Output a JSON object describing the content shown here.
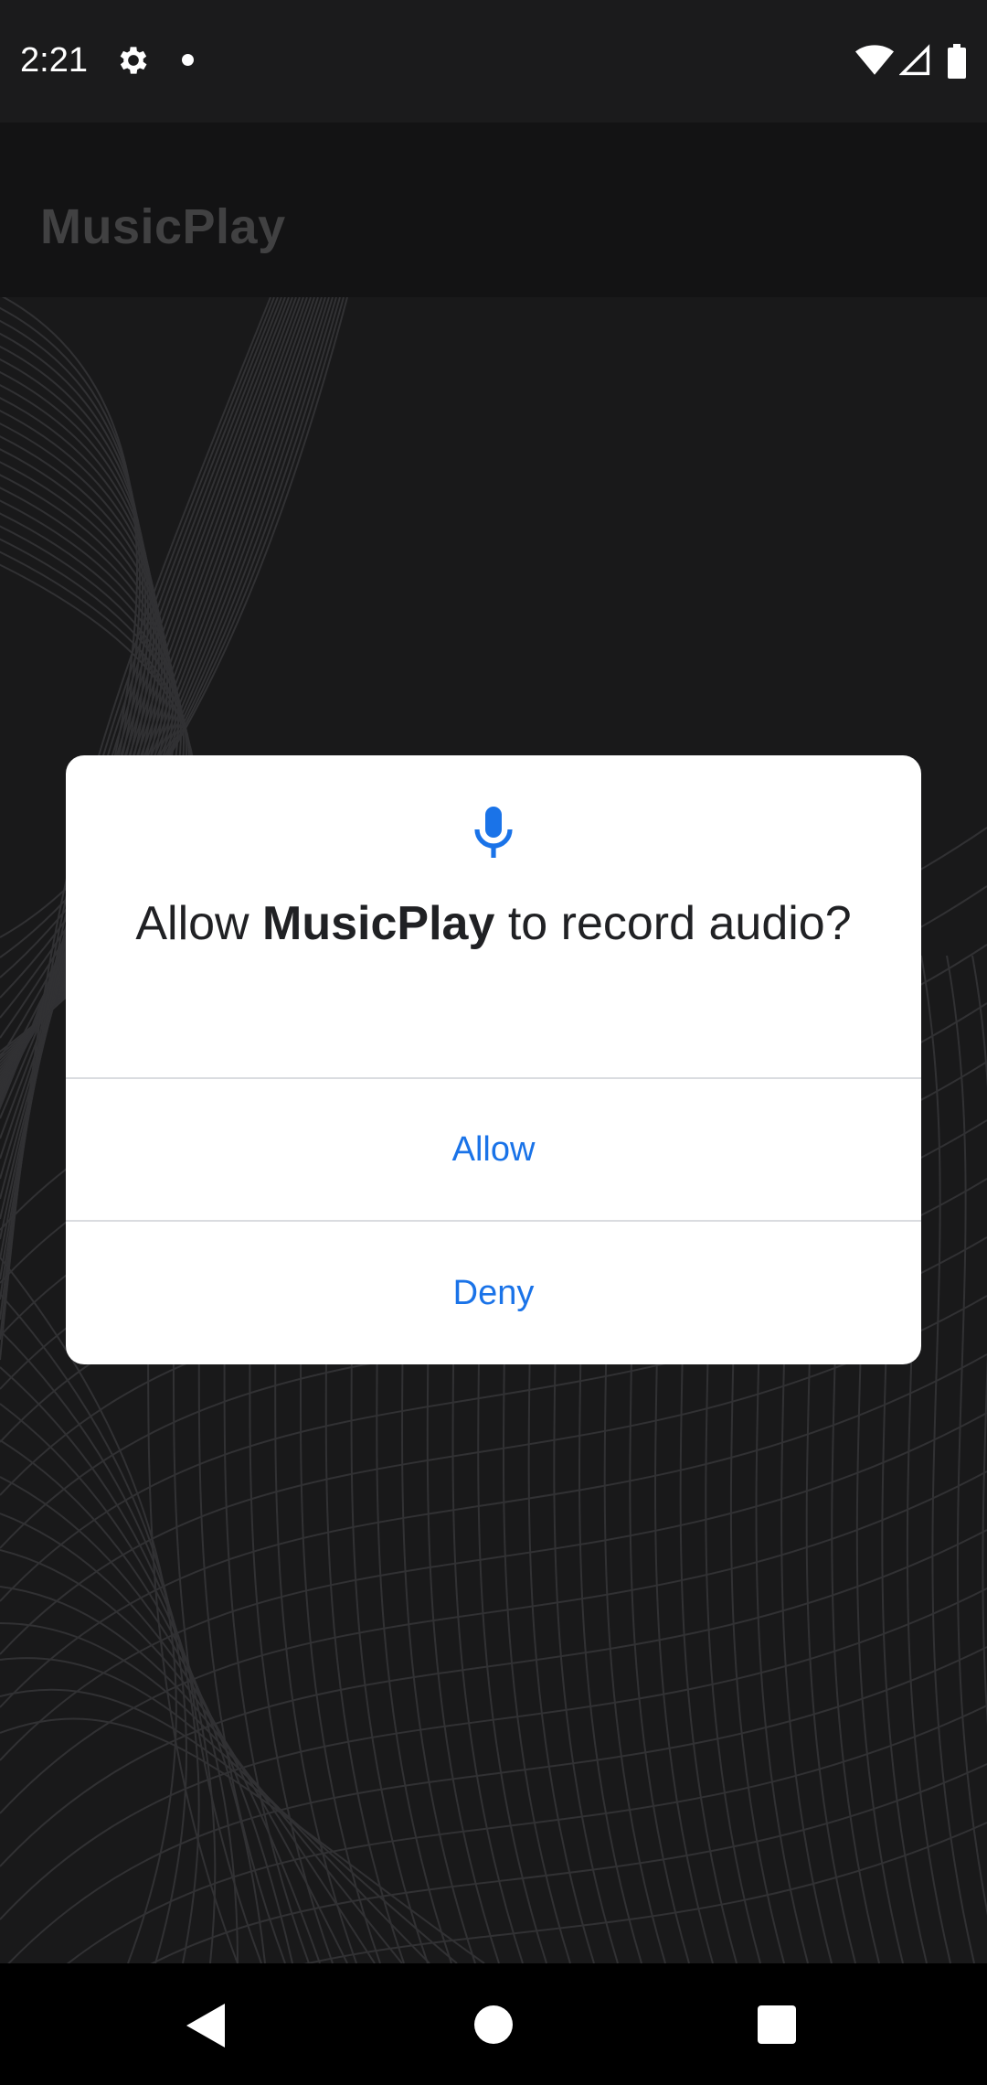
{
  "status_bar": {
    "time": "2:21",
    "icons": [
      "gear-icon",
      "notification-dot-icon",
      "wifi-icon",
      "signal-icon",
      "battery-icon"
    ]
  },
  "app_bar": {
    "title": "MusicPlay"
  },
  "permission_dialog": {
    "icon": "microphone-icon",
    "title_prefix": "Allow ",
    "app_name": "MusicPlay",
    "title_suffix": " to record audio?",
    "allow_label": "Allow",
    "deny_label": "Deny"
  },
  "nav_bar": {
    "icons": [
      "back-icon",
      "home-icon",
      "recents-icon"
    ]
  },
  "colors": {
    "accent": "#1a73e8",
    "background": "#232325",
    "bar": "#1b1b1c",
    "dialog": "#ffffff"
  }
}
